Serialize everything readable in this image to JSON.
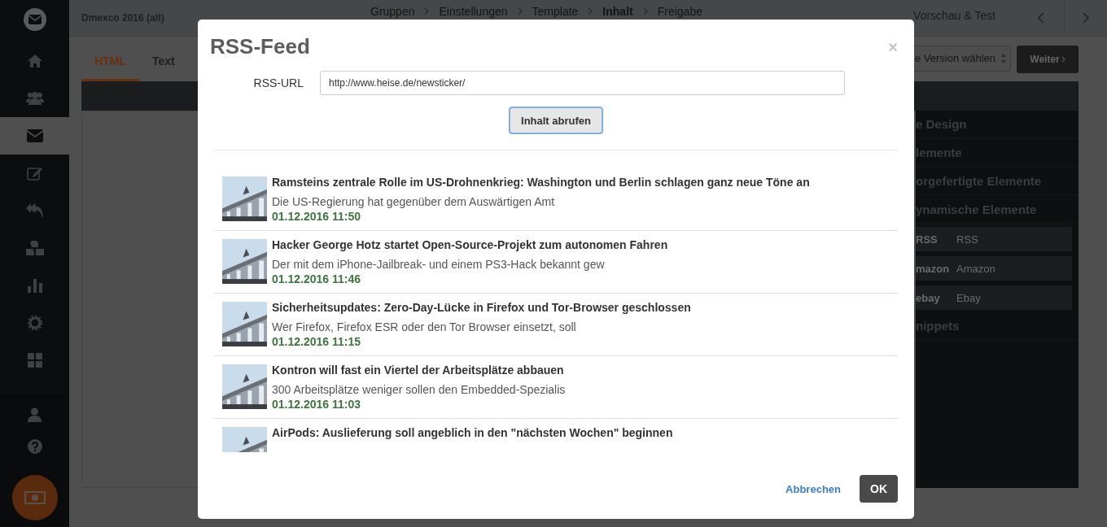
{
  "app": {
    "project": "Dmexco 2016 (alt)",
    "breadcrumbs": [
      {
        "label": "Gruppen",
        "selected": false
      },
      {
        "label": "Einstellungen",
        "selected": false
      },
      {
        "label": "Template",
        "selected": false
      },
      {
        "label": "Inhalt",
        "selected": true
      },
      {
        "label": "Freigabe",
        "selected": false
      }
    ],
    "preview": "Vorschau & Test",
    "sidebar": [
      {
        "kind": "home",
        "selected": false
      },
      {
        "kind": "users",
        "selected": false
      },
      {
        "kind": "mail",
        "selected": true
      },
      {
        "kind": "edit",
        "selected": false
      },
      {
        "kind": "reply",
        "selected": false
      },
      {
        "kind": "cubes",
        "selected": false
      },
      {
        "kind": "chart",
        "selected": false
      },
      {
        "kind": "gear",
        "selected": false
      },
      {
        "kind": "grid",
        "selected": false
      }
    ],
    "sidebar_bottom": [
      {
        "kind": "user"
      },
      {
        "kind": "help"
      }
    ],
    "tabs": [
      {
        "label": "HTML",
        "selected": true
      },
      {
        "label": "Text",
        "selected": false
      }
    ],
    "version_select": "e Version wählen",
    "next_button": "Weiter",
    "panel": [
      {
        "kind": "section",
        "label": "e Design"
      },
      {
        "kind": "section",
        "label": "lemente"
      },
      {
        "kind": "section",
        "label": "orgefertigte Elemente"
      },
      {
        "kind": "section",
        "label": "ynamische Elemente"
      },
      {
        "kind": "item",
        "logo": "RSS",
        "label": "RSS"
      },
      {
        "kind": "item",
        "logo": "mazon",
        "label": "Amazon"
      },
      {
        "kind": "item",
        "logo": "ebay",
        "label": "Ebay"
      },
      {
        "kind": "section",
        "label": "nippets"
      }
    ]
  },
  "modal": {
    "title": "RSS-Feed",
    "close": "×",
    "url_label": "RSS-URL",
    "url_value": "http://www.heise.de/newsticker/",
    "fetch_button": "Inhalt abrufen",
    "items": [
      {
        "title": "Ramsteins zentrale Rolle im US-Drohnenkrieg: Washington und Berlin schlagen ganz neue Töne an",
        "summary": "Die US-Regierung hat gegenüber dem Auswärtigen Amt",
        "date": "01.12.2016 11:50"
      },
      {
        "title": "Hacker George Hotz startet Open-Source-Projekt zum autonomen Fahren",
        "summary": "Der mit dem iPhone-Jailbreak- und einem PS3-Hack bekannt gew",
        "date": "01.12.2016 11:46"
      },
      {
        "title": "Sicherheitsupdates: Zero-Day-Lücke in Firefox und Tor-Browser geschlossen",
        "summary": "Wer Firefox, Firefox ESR oder den Tor Browser einsetzt, soll",
        "date": "01.12.2016 11:15"
      },
      {
        "title": "Kontron will fast ein Viertel der Arbeitsplätze abbauen",
        "summary": "300 Arbeitsplätze weniger sollen den Embedded-Spezialis",
        "date": "01.12.2016 11:03"
      },
      {
        "title": "AirPods: Auslieferung soll angeblich in den \"nächsten Wochen\" beginnen"
      }
    ],
    "cancel_button": "Abbrechen",
    "ok_button": "OK"
  }
}
